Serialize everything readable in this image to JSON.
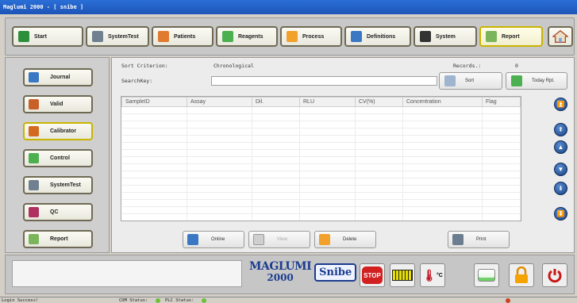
{
  "window": {
    "title": "Maglumi 2000 - [ snibe ]"
  },
  "nav": {
    "items": [
      {
        "label": "Start",
        "icon": "monitor-icon"
      },
      {
        "label": "SystemTest",
        "icon": "calculator-icon"
      },
      {
        "label": "Patients",
        "icon": "people-icon"
      },
      {
        "label": "Reagents",
        "icon": "pipette-icon"
      },
      {
        "label": "Process",
        "icon": "process-icon"
      },
      {
        "label": "Definitions",
        "icon": "definitions-icon"
      },
      {
        "label": "System",
        "icon": "computer-icon"
      },
      {
        "label": "Report",
        "icon": "report-icon"
      }
    ],
    "active": "Report"
  },
  "sidebar": {
    "items": [
      {
        "label": "Journal",
        "icon": "journal-icon"
      },
      {
        "label": "Valid",
        "icon": "valid-icon"
      },
      {
        "label": "Calibrator",
        "icon": "calibrator-icon"
      },
      {
        "label": "Control",
        "icon": "control-icon"
      },
      {
        "label": "SystemTest",
        "icon": "calculator-icon"
      },
      {
        "label": "QC",
        "icon": "qc-icon"
      },
      {
        "label": "Report",
        "icon": "report-icon"
      }
    ]
  },
  "main": {
    "sort_label": "Sort Criterion:",
    "sort_value": "Chronological",
    "records_label": "Records.:",
    "records_value": "0",
    "search_label": "SearchKey:",
    "search_value": "",
    "sort_button": "Sort",
    "today_button": "Today Rpt.",
    "columns": [
      "SampleID",
      "Assay",
      "Dil.",
      "RLU",
      "CV(%)",
      "Concentration",
      "Flag"
    ],
    "rows": [],
    "bottom_buttons": [
      {
        "label": "Online",
        "icon": "online-icon",
        "enabled": true
      },
      {
        "label": "View",
        "icon": "view-icon",
        "enabled": false
      },
      {
        "label": "Delete",
        "icon": "delete-icon",
        "enabled": true
      },
      {
        "label": "Print",
        "icon": "print-icon",
        "enabled": true
      }
    ]
  },
  "footer": {
    "logo_line1": "MAGLUMI",
    "logo_line2": "2000",
    "brand": "Snibe",
    "stop_label": "STOP",
    "temp_label": "°C"
  },
  "statusbar": {
    "message": "Login Success!",
    "com_label": "COM Status:",
    "plc_label": "PLC Status:"
  },
  "colors": {
    "title_bar": "#1d54b8",
    "active_border": "#c9b400",
    "scroll_button": "#1f4f96",
    "status_ok": "#6fbf3a",
    "stop": "#d22020"
  }
}
